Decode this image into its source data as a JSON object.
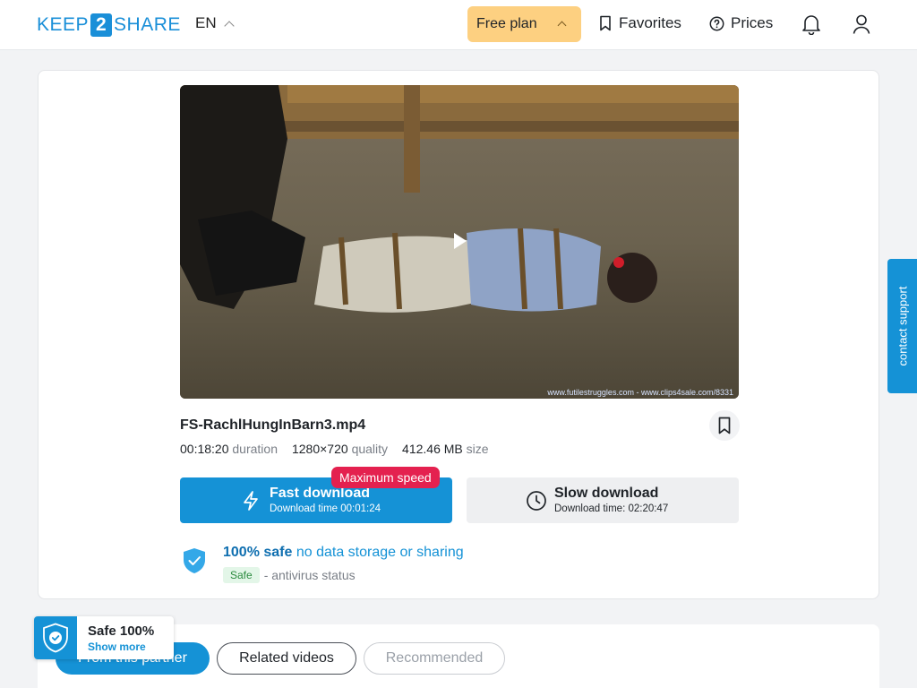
{
  "header": {
    "logo": {
      "left": "KEEP",
      "mid": "2",
      "right": "SHARE"
    },
    "language": "EN",
    "plan": "Free plan",
    "favorites": "Favorites",
    "prices": "Prices"
  },
  "file": {
    "name": "FS-RachlHungInBarn3.mp4",
    "duration": "00:18:20",
    "duration_label": "duration",
    "quality": "1280×720",
    "quality_label": "quality",
    "size": "412.46 MB",
    "size_label": "size",
    "watermark": "www.futilestruggles.com - www.clips4sale.com/8331"
  },
  "fast": {
    "badge": "Maximum speed",
    "title": "Fast download",
    "time": "Download time 00:01:24"
  },
  "slow": {
    "title": "Slow download",
    "time": "Download time: 02:20:47"
  },
  "safety": {
    "bold": "100% safe",
    "note": "no data storage or sharing",
    "badge": "Safe",
    "status": "- antivirus status"
  },
  "support": "contact support",
  "tabs": [
    "From this partner",
    "Related videos",
    "Recommended"
  ],
  "widget": {
    "title": "Safe 100%",
    "link": "Show more"
  },
  "colors": {
    "accent": "#1592d6",
    "plan": "#fdd081",
    "badge": "#e4214f"
  }
}
